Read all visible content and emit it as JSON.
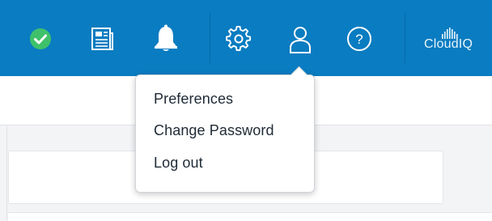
{
  "header": {
    "status_icon": "check-circle-icon",
    "icons": [
      "check-circle-icon",
      "news-icon",
      "bell-icon",
      "gear-icon",
      "user-icon",
      "help-icon"
    ],
    "brand_text": "CloudIQ",
    "colors": {
      "header_bg": "#0a7cc1",
      "status_green": "#3fc16b",
      "icon_white": "#ffffff"
    }
  },
  "user_menu": {
    "items": [
      {
        "label": "Preferences"
      },
      {
        "label": "Change Password"
      },
      {
        "label": "Log out"
      }
    ]
  }
}
